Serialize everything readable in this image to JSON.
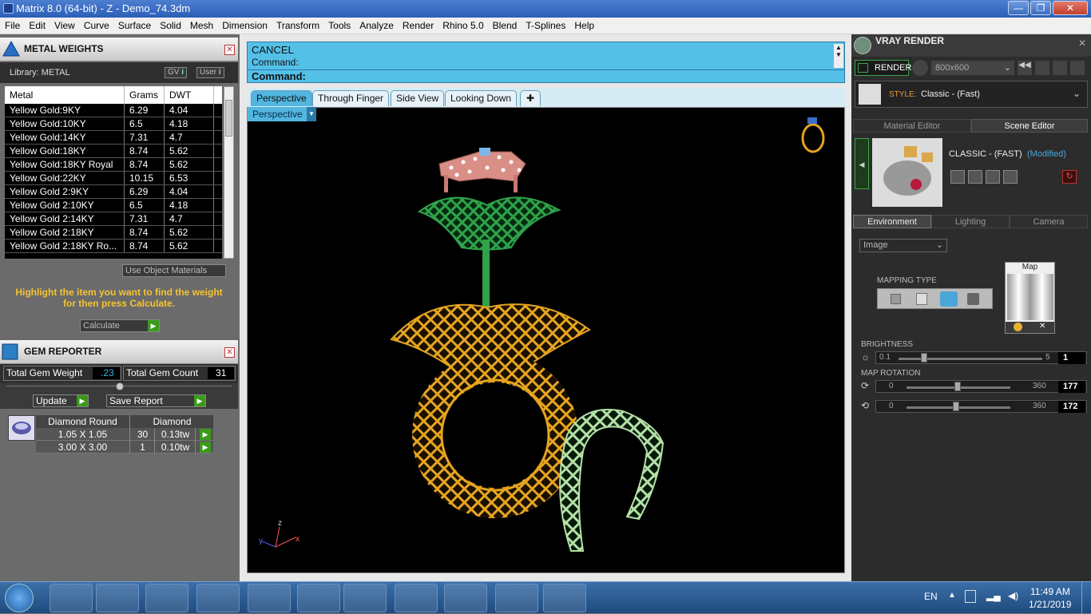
{
  "window": {
    "title": "Matrix 8.0 (64-bit) - Z - Demo_74.3dm",
    "min": "—",
    "max": "❐",
    "close": "✕"
  },
  "menu": [
    "File",
    "Edit",
    "View",
    "Curve",
    "Surface",
    "Solid",
    "Mesh",
    "Dimension",
    "Transform",
    "Tools",
    "Analyze",
    "Render",
    "Rhino 5.0",
    "Blend",
    "T-Splines",
    "Help"
  ],
  "metal_weights": {
    "title": "METAL WEIGHTS",
    "library": "Library: METAL",
    "gv": "GV",
    "user": "User",
    "columns": [
      "Metal",
      "Grams",
      "DWT"
    ],
    "rows": [
      [
        "Yellow Gold:9KY",
        "6.29",
        "4.04"
      ],
      [
        "Yellow Gold:10KY",
        "6.5",
        "4.18"
      ],
      [
        "Yellow Gold:14KY",
        "7.31",
        "4.7"
      ],
      [
        "Yellow Gold:18KY",
        "8.74",
        "5.62"
      ],
      [
        "Yellow Gold:18KY Royal",
        "8.74",
        "5.62"
      ],
      [
        "Yellow Gold:22KY",
        "10.15",
        "6.53"
      ],
      [
        "Yellow Gold 2:9KY",
        "6.29",
        "4.04"
      ],
      [
        "Yellow Gold 2:10KY",
        "6.5",
        "4.18"
      ],
      [
        "Yellow Gold 2:14KY",
        "7.31",
        "4.7"
      ],
      [
        "Yellow Gold 2:18KY",
        "8.74",
        "5.62"
      ],
      [
        "Yellow Gold 2:18KY Ro...",
        "8.74",
        "5.62"
      ]
    ],
    "use_object_materials": "Use Object Materials",
    "instruction": "Highlight the item you want to find the weight for then press Calculate.",
    "calculate": "Calculate"
  },
  "gem_reporter": {
    "title": "GEM REPORTER",
    "total_weight_label": "Total Gem Weight",
    "total_weight_value": ".23",
    "total_count_label": "Total Gem Count",
    "total_count_value": "31",
    "update": "Update",
    "save_report": "Save Report",
    "columns": [
      "Diamond Round",
      "Diamond"
    ],
    "rows": [
      {
        "size": "1.05 X 1.05",
        "count": "30",
        "tw": "0.13tw"
      },
      {
        "size": "3.00 X 3.00",
        "count": "1",
        "tw": "0.10tw"
      }
    ]
  },
  "command": {
    "line1": "CANCEL",
    "line2": "Command:",
    "prompt": "Command:"
  },
  "tabs": [
    "Perspective",
    "Through Finger",
    "Side View",
    "Looking Down"
  ],
  "viewport_label": "Perspective",
  "axes": {
    "z": "z",
    "y": "y",
    "x": "x"
  },
  "vray": {
    "title": "VRAY RENDER",
    "render": "RENDER",
    "resolution": "800x600",
    "style_label": "STYLE:",
    "style_value": "Classic - (Fast)",
    "subtabs": [
      "Material Editor",
      "Scene Editor"
    ],
    "scene_name": "CLASSIC - (FAST)",
    "modified": "(Modified)",
    "env_tabs": [
      "Environment",
      "Lighting",
      "Camera"
    ],
    "image_dropdown": "Image",
    "mapping_type": "MAPPING TYPE",
    "map_label": "Map",
    "brightness": {
      "label": "BRIGHTNESS",
      "min": "0.1",
      "max": "5",
      "value": "1"
    },
    "map_rotation": {
      "label": "MAP ROTATION",
      "min": "0",
      "max": "360",
      "value1": "177",
      "value2": "172",
      "min2": "0",
      "max2": "360"
    }
  },
  "taskbar": {
    "lang": "EN",
    "time": "11:49 AM",
    "date": "1/21/2019"
  }
}
